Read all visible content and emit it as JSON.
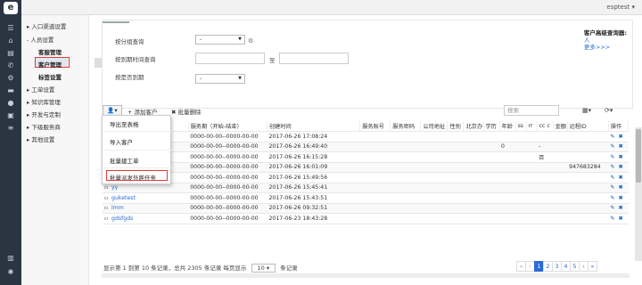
{
  "header": {
    "username": "esptest",
    "user_caret": "▾"
  },
  "iconbar": {
    "logo_char": "e"
  },
  "sidebar": {
    "items": [
      {
        "label": "入口渠道设置",
        "level": 1
      },
      {
        "label": "人员设置",
        "level": 1
      },
      {
        "label": "客服管理",
        "level": 2
      },
      {
        "label": "客户管理",
        "level": 2
      },
      {
        "label": "标签设置",
        "level": 2
      },
      {
        "label": "工单设置",
        "level": 1
      },
      {
        "label": "知识库管理",
        "level": 1
      },
      {
        "label": "开发与定制",
        "level": 1
      },
      {
        "label": "下级服务商",
        "level": 1
      },
      {
        "label": "其他设置",
        "level": 1
      }
    ],
    "selected": "客户管理"
  },
  "filters": {
    "group_label": "按分组查询",
    "group_value": "-",
    "service_time_label": "按到期时间查询",
    "to_text": "至",
    "expired_label": "按是否到期",
    "expired_value": "-"
  },
  "advanced": {
    "title": "客户高级查询器:",
    "link1": "人",
    "link2": "更多>>>"
  },
  "toolbar": {
    "export_caret": "▾",
    "add_label": "+ 添加客户",
    "batch_delete_label": "✖ 批量删除",
    "search_placeholder": "搜索",
    "columns_icon": "▦▾",
    "refresh_icon": "⟳▾"
  },
  "dropdown": {
    "items": [
      "导出至表格",
      "导入客户",
      "批量建工单",
      "批量派发外呼任务"
    ]
  },
  "table": {
    "columns": [
      "",
      "",
      "服务期（开始-结束）",
      "创建时间",
      "服务账号",
      "服务密码",
      "公司地址",
      "性别",
      "北京办",
      "学历",
      "年龄",
      "ss",
      "rr",
      "cc c",
      "金额",
      "远程ID",
      "操作"
    ],
    "rows": [
      {
        "name": "",
        "period": "0000-00-00--0000-00-00",
        "created": "2017-06-26 17:08:24",
        "age": "",
        "rr": "",
        "remote": ""
      },
      {
        "name": "",
        "period": "0000-00-00--0000-00-00",
        "created": "2017-06-26 16:49:40",
        "age": "0",
        "rr": "-",
        "remote": ""
      },
      {
        "name": "",
        "period": "0000-00-00--0000-00-00",
        "created": "2017-06-26 16:15:28",
        "age": "",
        "rr": "否",
        "remote": ""
      },
      {
        "name": "",
        "period": "0000-00-00--0000-00-00",
        "created": "2017-06-26 16:01:09",
        "age": "",
        "rr": "",
        "remote": "947683284"
      },
      {
        "name": "xinjianxinjianhahha",
        "period": "0000-00-00--0000-00-00",
        "created": "2017-06-26 15:49:56",
        "age": "",
        "rr": "",
        "remote": ""
      },
      {
        "name": "yy",
        "period": "0000-00-00--0000-00-00",
        "created": "2017-06-26 15:45:41",
        "age": "",
        "rr": "",
        "remote": ""
      },
      {
        "name": "guketest",
        "period": "0000-00-00--0000-00-00",
        "created": "2017-06-26 15:43:51",
        "age": "",
        "rr": "",
        "remote": ""
      },
      {
        "name": "lmm",
        "period": "0000-00-00--0000-00-00",
        "created": "2017-06-26 09:32:51",
        "age": "",
        "rr": "",
        "remote": ""
      },
      {
        "name": "gdsfgds",
        "period": "0000-00-00--0000-00-00",
        "created": "2017-06-23 18:43:28",
        "age": "",
        "rr": "",
        "remote": ""
      }
    ]
  },
  "footer": {
    "summary": "显示第 1 到第 10 条记录，总共 2305 条记录 每页显示",
    "page_size": "10",
    "page_size_caret": "▾",
    "suffix": "条记录"
  },
  "pager": {
    "pages": [
      "«",
      "‹",
      "1",
      "2",
      "3",
      "4",
      "5",
      "›",
      "»"
    ],
    "current": "1"
  },
  "colors": {
    "accent": "#2a6bd6",
    "highlight": "#e53935",
    "iconbar": "#2b3542"
  }
}
